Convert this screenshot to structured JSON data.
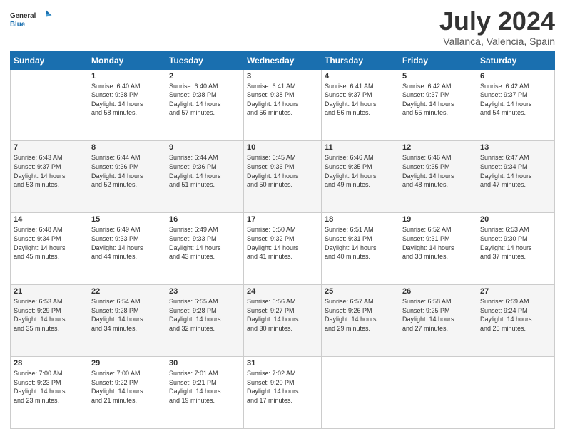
{
  "logo": {
    "line1": "General",
    "line2": "Blue"
  },
  "title": "July 2024",
  "subtitle": "Vallanca, Valencia, Spain",
  "days_header": [
    "Sunday",
    "Monday",
    "Tuesday",
    "Wednesday",
    "Thursday",
    "Friday",
    "Saturday"
  ],
  "weeks": [
    [
      {
        "day": "",
        "info": ""
      },
      {
        "day": "1",
        "info": "Sunrise: 6:40 AM\nSunset: 9:38 PM\nDaylight: 14 hours\nand 58 minutes."
      },
      {
        "day": "2",
        "info": "Sunrise: 6:40 AM\nSunset: 9:38 PM\nDaylight: 14 hours\nand 57 minutes."
      },
      {
        "day": "3",
        "info": "Sunrise: 6:41 AM\nSunset: 9:38 PM\nDaylight: 14 hours\nand 56 minutes."
      },
      {
        "day": "4",
        "info": "Sunrise: 6:41 AM\nSunset: 9:37 PM\nDaylight: 14 hours\nand 56 minutes."
      },
      {
        "day": "5",
        "info": "Sunrise: 6:42 AM\nSunset: 9:37 PM\nDaylight: 14 hours\nand 55 minutes."
      },
      {
        "day": "6",
        "info": "Sunrise: 6:42 AM\nSunset: 9:37 PM\nDaylight: 14 hours\nand 54 minutes."
      }
    ],
    [
      {
        "day": "7",
        "info": "Sunrise: 6:43 AM\nSunset: 9:37 PM\nDaylight: 14 hours\nand 53 minutes."
      },
      {
        "day": "8",
        "info": "Sunrise: 6:44 AM\nSunset: 9:36 PM\nDaylight: 14 hours\nand 52 minutes."
      },
      {
        "day": "9",
        "info": "Sunrise: 6:44 AM\nSunset: 9:36 PM\nDaylight: 14 hours\nand 51 minutes."
      },
      {
        "day": "10",
        "info": "Sunrise: 6:45 AM\nSunset: 9:36 PM\nDaylight: 14 hours\nand 50 minutes."
      },
      {
        "day": "11",
        "info": "Sunrise: 6:46 AM\nSunset: 9:35 PM\nDaylight: 14 hours\nand 49 minutes."
      },
      {
        "day": "12",
        "info": "Sunrise: 6:46 AM\nSunset: 9:35 PM\nDaylight: 14 hours\nand 48 minutes."
      },
      {
        "day": "13",
        "info": "Sunrise: 6:47 AM\nSunset: 9:34 PM\nDaylight: 14 hours\nand 47 minutes."
      }
    ],
    [
      {
        "day": "14",
        "info": "Sunrise: 6:48 AM\nSunset: 9:34 PM\nDaylight: 14 hours\nand 45 minutes."
      },
      {
        "day": "15",
        "info": "Sunrise: 6:49 AM\nSunset: 9:33 PM\nDaylight: 14 hours\nand 44 minutes."
      },
      {
        "day": "16",
        "info": "Sunrise: 6:49 AM\nSunset: 9:33 PM\nDaylight: 14 hours\nand 43 minutes."
      },
      {
        "day": "17",
        "info": "Sunrise: 6:50 AM\nSunset: 9:32 PM\nDaylight: 14 hours\nand 41 minutes."
      },
      {
        "day": "18",
        "info": "Sunrise: 6:51 AM\nSunset: 9:31 PM\nDaylight: 14 hours\nand 40 minutes."
      },
      {
        "day": "19",
        "info": "Sunrise: 6:52 AM\nSunset: 9:31 PM\nDaylight: 14 hours\nand 38 minutes."
      },
      {
        "day": "20",
        "info": "Sunrise: 6:53 AM\nSunset: 9:30 PM\nDaylight: 14 hours\nand 37 minutes."
      }
    ],
    [
      {
        "day": "21",
        "info": "Sunrise: 6:53 AM\nSunset: 9:29 PM\nDaylight: 14 hours\nand 35 minutes."
      },
      {
        "day": "22",
        "info": "Sunrise: 6:54 AM\nSunset: 9:28 PM\nDaylight: 14 hours\nand 34 minutes."
      },
      {
        "day": "23",
        "info": "Sunrise: 6:55 AM\nSunset: 9:28 PM\nDaylight: 14 hours\nand 32 minutes."
      },
      {
        "day": "24",
        "info": "Sunrise: 6:56 AM\nSunset: 9:27 PM\nDaylight: 14 hours\nand 30 minutes."
      },
      {
        "day": "25",
        "info": "Sunrise: 6:57 AM\nSunset: 9:26 PM\nDaylight: 14 hours\nand 29 minutes."
      },
      {
        "day": "26",
        "info": "Sunrise: 6:58 AM\nSunset: 9:25 PM\nDaylight: 14 hours\nand 27 minutes."
      },
      {
        "day": "27",
        "info": "Sunrise: 6:59 AM\nSunset: 9:24 PM\nDaylight: 14 hours\nand 25 minutes."
      }
    ],
    [
      {
        "day": "28",
        "info": "Sunrise: 7:00 AM\nSunset: 9:23 PM\nDaylight: 14 hours\nand 23 minutes."
      },
      {
        "day": "29",
        "info": "Sunrise: 7:00 AM\nSunset: 9:22 PM\nDaylight: 14 hours\nand 21 minutes."
      },
      {
        "day": "30",
        "info": "Sunrise: 7:01 AM\nSunset: 9:21 PM\nDaylight: 14 hours\nand 19 minutes."
      },
      {
        "day": "31",
        "info": "Sunrise: 7:02 AM\nSunset: 9:20 PM\nDaylight: 14 hours\nand 17 minutes."
      },
      {
        "day": "",
        "info": ""
      },
      {
        "day": "",
        "info": ""
      },
      {
        "day": "",
        "info": ""
      }
    ]
  ]
}
